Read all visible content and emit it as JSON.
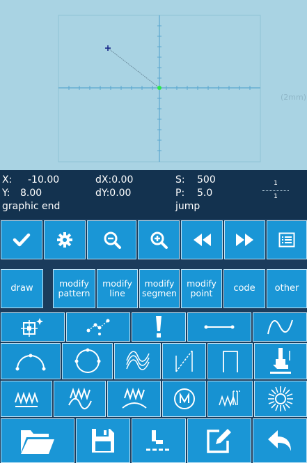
{
  "canvas": {
    "scale_label": "(2mm)"
  },
  "status": {
    "x_label": "X:",
    "x_value": "-10.00",
    "dx": "dX:0.00",
    "s_label": "S:",
    "s_value": "500",
    "y_label": "Y:",
    "y_value": "8.00",
    "dy": "dY:0.00",
    "p_label": "P:",
    "p_value": "5.0",
    "message": "graphic end",
    "mode": "jump",
    "page_top": "1",
    "page_bottom": "1"
  },
  "toolbar_icons": [
    "check-icon",
    "gear-icon",
    "zoom-out-icon",
    "zoom-in-icon",
    "rewind-icon",
    "fast-forward-icon",
    "list-icon"
  ],
  "menu": {
    "draw": "draw",
    "modify_pattern": "modify\npattern",
    "modify_line": "modify\nline",
    "modify_segment": "modify\nsegmen",
    "modify_point": "modify\npoint",
    "code": "code",
    "other": "other"
  },
  "colors": {
    "canvas_bg": "#a9d3e3",
    "status_bg": "#13324f",
    "button_bg": "#1a96d6",
    "button_border": "#bfe2f5",
    "origin_point": "#2ee84a"
  }
}
